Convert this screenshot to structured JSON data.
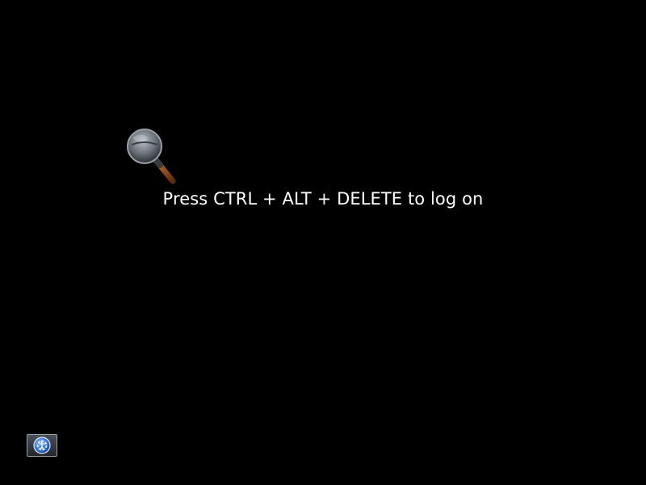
{
  "screen": {
    "prompt_text": "Press CTRL + ALT + DELETE to log on",
    "background_color": "#000000",
    "text_color": "#ffffff"
  },
  "icons": {
    "magnifier": "magnifier-icon",
    "ease_of_access": "ease-of-access-icon"
  },
  "accent_colors": {
    "ease_of_access_blue": "#2f6fd6",
    "magnifier_handle": "#8b4a18"
  }
}
